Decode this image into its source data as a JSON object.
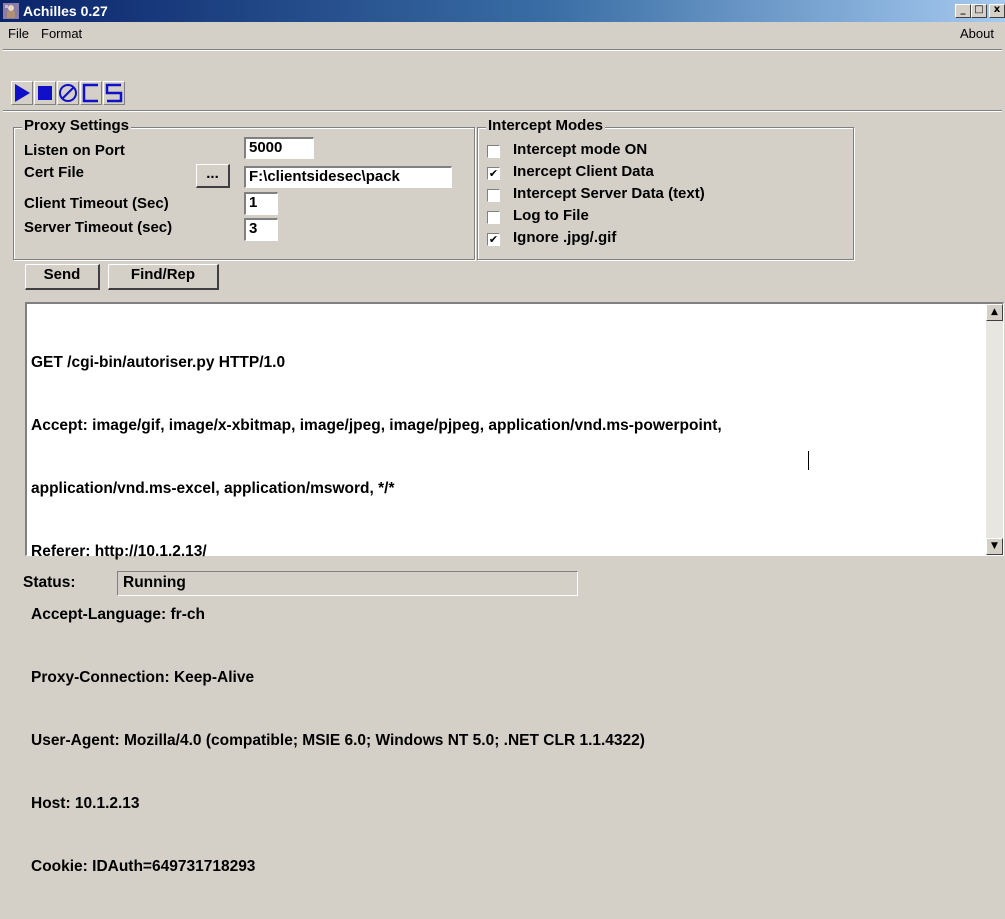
{
  "window": {
    "title": "Achilles 0.27",
    "icon": "achilles-icon"
  },
  "title_buttons": {
    "minimize": "_",
    "maximize": "□",
    "close": "x"
  },
  "menu": {
    "file": "File",
    "format": "Format",
    "about": "About"
  },
  "toolbar": {
    "items": [
      {
        "name": "play-icon"
      },
      {
        "name": "stop-icon"
      },
      {
        "name": "clear-icon"
      },
      {
        "name": "c-icon"
      },
      {
        "name": "s-icon"
      }
    ],
    "icon_color": "#1010c8"
  },
  "proxy": {
    "legend": "Proxy Settings",
    "listen_port_label": "Listen on Port",
    "listen_port": "5000",
    "cert_file_label": "Cert File",
    "cert_browse": "...",
    "cert_file": "F:\\clientsidesec\\pack",
    "client_timeout_label": "Client Timeout (Sec)",
    "client_timeout": "1",
    "server_timeout_label": "Server Timeout (sec)",
    "server_timeout": "3"
  },
  "intercept": {
    "legend": "Intercept Modes",
    "options": [
      {
        "label": "Intercept mode ON",
        "checked": false,
        "mark": ""
      },
      {
        "label": "Inercept Client Data",
        "checked": true,
        "mark": "✔"
      },
      {
        "label": "Intercept Server Data (text)",
        "checked": false,
        "mark": ""
      },
      {
        "label": "Log to File",
        "checked": false,
        "mark": ""
      },
      {
        "label": "Ignore .jpg/.gif",
        "checked": true,
        "mark": "✔"
      }
    ]
  },
  "actions": {
    "send": "Send",
    "find_replace": "Find/Rep"
  },
  "request": {
    "lines": [
      "GET /cgi-bin/autoriser.py HTTP/1.0",
      "Accept: image/gif, image/x-xbitmap, image/jpeg, image/pjpeg, application/vnd.ms-powerpoint,",
      "application/vnd.ms-excel, application/msword, */*",
      "Referer: http://10.1.2.13/",
      "Accept-Language: fr-ch",
      "Proxy-Connection: Keep-Alive",
      "User-Agent: Mozilla/4.0 (compatible; MSIE 6.0; Windows NT 5.0; .NET CLR 1.1.4322)",
      "Host: 10.1.2.13",
      "Cookie: IDAuth=649731718293"
    ]
  },
  "scrollbar": {
    "up": "▲",
    "down": "▼"
  },
  "status": {
    "label": "Status:",
    "value": "Running"
  }
}
